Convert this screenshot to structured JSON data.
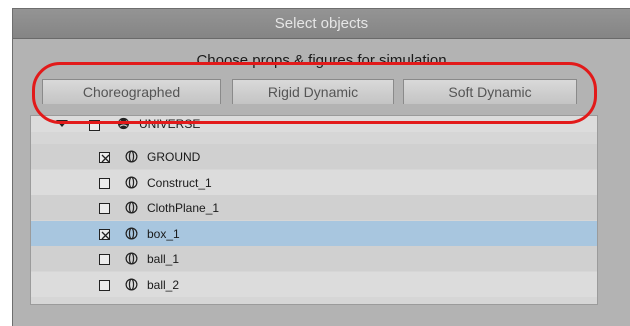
{
  "window": {
    "title": "Select objects"
  },
  "header": {
    "subtitle": "Choose props & figures for simulation"
  },
  "tabs": [
    {
      "label": "Choreographed"
    },
    {
      "label": "Rigid Dynamic"
    },
    {
      "label": "Soft Dynamic"
    }
  ],
  "tree": {
    "root": {
      "label": "UNIVERSE",
      "checked": false,
      "expanded": true,
      "icon": "globe-icon"
    },
    "items": [
      {
        "label": "GROUND",
        "checked": true,
        "selected": false,
        "icon": "prop-icon"
      },
      {
        "label": "Construct_1",
        "checked": false,
        "selected": false,
        "icon": "prop-icon"
      },
      {
        "label": "ClothPlane_1",
        "checked": false,
        "selected": false,
        "icon": "prop-icon"
      },
      {
        "label": "box_1",
        "checked": true,
        "selected": true,
        "icon": "prop-icon"
      },
      {
        "label": "ball_1",
        "checked": false,
        "selected": false,
        "icon": "prop-icon"
      },
      {
        "label": "ball_2",
        "checked": false,
        "selected": false,
        "icon": "prop-icon"
      }
    ]
  },
  "colors": {
    "selection": "#a8c6df",
    "highlight_ring": "#e21a1a",
    "panel": "#b3b3b3"
  }
}
